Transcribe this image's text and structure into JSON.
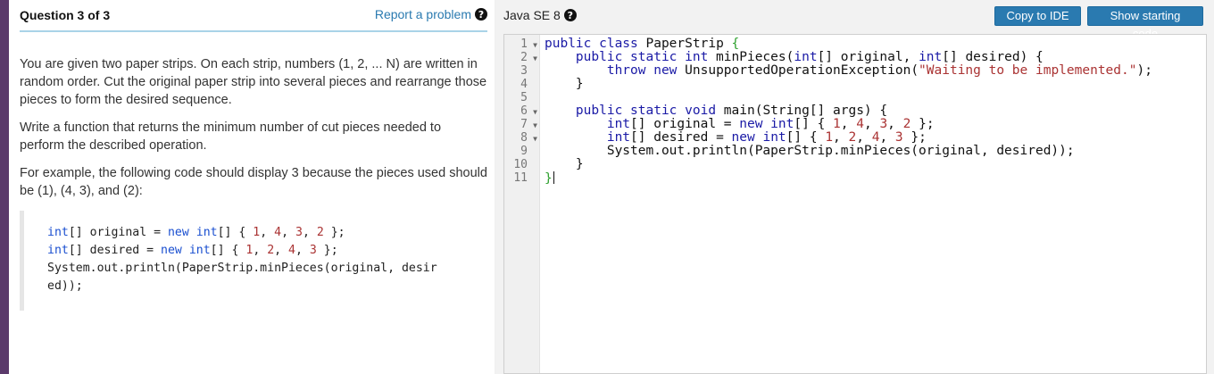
{
  "question": {
    "title": "Question 3 of 3",
    "report_label": "Report a problem",
    "paragraphs": [
      "You are given two paper strips. On each strip, numbers (1, 2, ... N) are written in random order. Cut the original paper strip into several pieces and rearrange those pieces to form the desired sequence.",
      "Write a function that returns the minimum number of cut pieces needed to perform the described operation.",
      "For example, the following code should display 3 because the pieces used should be (1), (4, 3), and (2):"
    ],
    "example": {
      "line1_kw1": "int",
      "line1_a": "[] original = ",
      "line1_kw2": "new",
      "line1_sp": " ",
      "line1_kw3": "int",
      "line1_b": "[] { ",
      "line1_n1": "1",
      "line1_c1": ", ",
      "line1_n2": "4",
      "line1_c2": ", ",
      "line1_n3": "3",
      "line1_c3": ", ",
      "line1_n4": "2",
      "line1_end": " };",
      "line2_kw1": "int",
      "line2_a": "[] desired = ",
      "line2_kw2": "new",
      "line2_sp": " ",
      "line2_kw3": "int",
      "line2_b": "[] { ",
      "line2_n1": "1",
      "line2_c1": ", ",
      "line2_n2": "2",
      "line2_c2": ", ",
      "line2_n3": "4",
      "line2_c3": ", ",
      "line2_n4": "3",
      "line2_end": " };",
      "line3": "System.out.println(PaperStrip.minPieces(original, desir",
      "line4": "ed));"
    }
  },
  "editor": {
    "language": "Java SE 8",
    "copy_button": "Copy to IDE",
    "starting_code_button": "Show starting code",
    "line_numbers": [
      "1",
      "2",
      "3",
      "4",
      "5",
      "6",
      "7",
      "8",
      "9",
      "10",
      "11"
    ],
    "code": {
      "l1_kw": "public class",
      "l1_rest": " PaperStrip ",
      "l1_brace": "{",
      "l2_indent": "    ",
      "l2_kw1": "public static int",
      "l2_a": " minPieces(",
      "l2_kw2": "int",
      "l2_b": "[] original, ",
      "l2_kw3": "int",
      "l2_c": "[] desired) {",
      "l3_indent": "        ",
      "l3_kw1": "throw new",
      "l3_a": " UnsupportedOperationException(",
      "l3_str": "\"Waiting to be implemented.\"",
      "l3_end": ");",
      "l4": "    }",
      "l5": "",
      "l6_indent": "    ",
      "l6_kw": "public static void",
      "l6_rest": " main(String[] args) {",
      "l7_indent": "        ",
      "l7_kw1": "int",
      "l7_a": "[] original = ",
      "l7_kw2": "new int",
      "l7_b": "[] { ",
      "l7_n1": "1",
      "l7_n2": "4",
      "l7_n3": "3",
      "l7_n4": "2",
      "l7_end": " };",
      "l8_indent": "        ",
      "l8_kw1": "int",
      "l8_a": "[] desired = ",
      "l8_kw2": "new int",
      "l8_b": "[] { ",
      "l8_n1": "1",
      "l8_n2": "2",
      "l8_n3": "4",
      "l8_n4": "3",
      "l8_end": " };",
      "l9": "        System.out.println(PaperStrip.minPieces(original, desired));",
      "l10": "    }",
      "l11": "}",
      "sep": ", "
    }
  },
  "colors": {
    "accent_bar": "#5b3a6b",
    "link": "#2a7ab0",
    "button": "#2a7ab0",
    "keyword": "#1a1aa6",
    "number": "#aa3333"
  }
}
